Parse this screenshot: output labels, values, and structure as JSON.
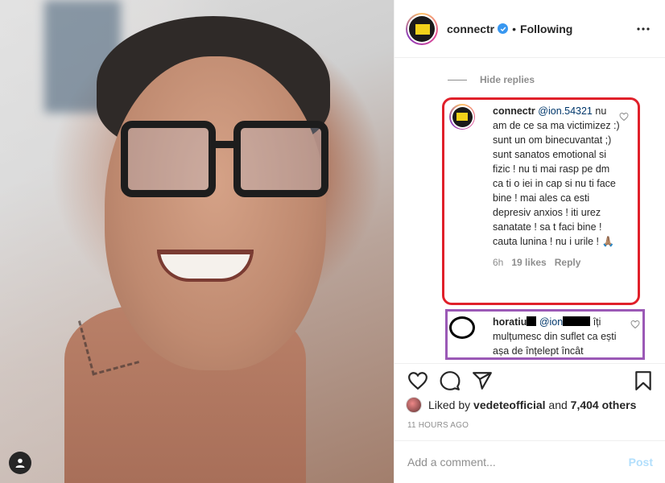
{
  "header": {
    "username": "connectr",
    "separator": "•",
    "follow_state": "Following"
  },
  "comments": {
    "hide_replies_label": "Hide replies",
    "reply1": {
      "username": "connectr",
      "mention": "@ion.54321",
      "text": " nu am de ce sa ma victimizez :) sunt un om binecuvantat ;) sunt sanatos emotional si fizic ! nu ti mai rasp pe dm ca ti o iei in cap si nu ti face bine ! mai ales ca esti depresiv anxios ! iti urez sanatate ! sa t faci bine ! cauta lunina ! nu i urile ! 🙏🏽",
      "age": "6h",
      "likes": "19 likes",
      "reply_label": "Reply"
    },
    "reply2": {
      "username": "horatiu",
      "mention": "@ion",
      "text": " îți mulțumesc din suflet ca ești așa de înțelept încât"
    }
  },
  "footer": {
    "liked_prefix": "Liked by ",
    "liked_user": "vedeteofficial",
    "liked_and": " and ",
    "liked_count": "7,404 others",
    "timestamp": "11 HOURS AGO",
    "comment_placeholder": "Add a comment...",
    "post_label": "Post"
  },
  "colors": {
    "accent_link": "#00376b",
    "highlight_red": "#e0202a",
    "highlight_purple": "#9b59b6",
    "verified_blue": "#3897f0",
    "post_disabled": "#b2dffc"
  },
  "icons": [
    "user-tag-icon",
    "verified-badge-icon",
    "more-options-icon",
    "heart-icon",
    "comment-icon",
    "share-icon",
    "bookmark-icon",
    "small-heart-icon"
  ]
}
